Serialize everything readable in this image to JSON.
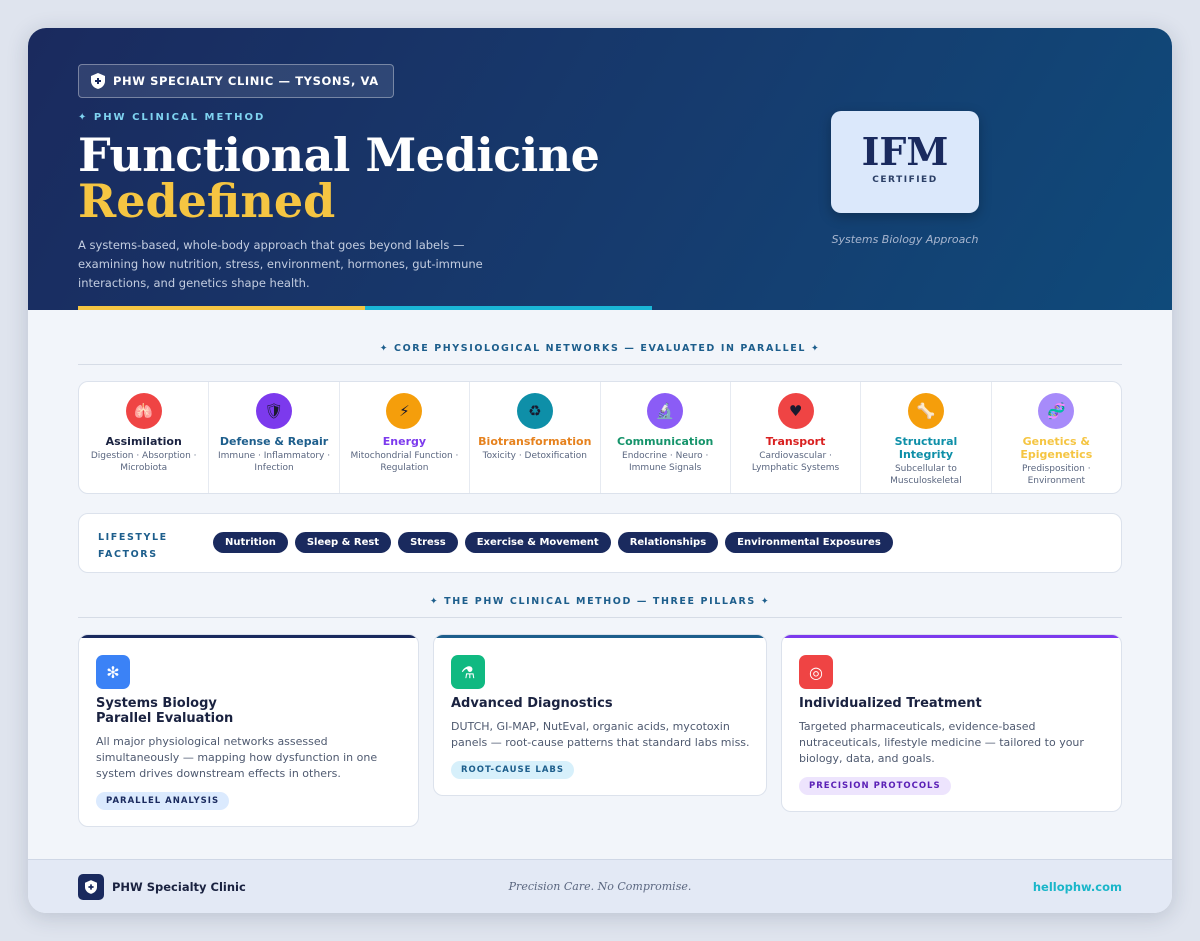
{
  "hero": {
    "badge": "PHW SPECIALTY CLINIC — TYSONS, VA",
    "eyebrow": "✦ PHW CLINICAL METHOD",
    "title_line1": "Functional Medicine",
    "title_line2": "Redefined",
    "description": "A systems-based, whole-body approach that goes beyond labels — examining how nutrition, stress, environment, hormones, gut-immune interactions, and genetics shape health.",
    "ifm_text": "IFM",
    "ifm_sub": "CERTIFIED",
    "ifm_caption": "Systems Biology Approach"
  },
  "networks_section": {
    "heading": "✦   CORE PHYSIOLOGICAL NETWORKS — EVALUATED IN PARALLEL   ✦",
    "items": [
      {
        "title": "Assimilation",
        "sub": "Digestion · Absorption · Microbiota",
        "icon": "lungs-icon",
        "glyph": "🫁",
        "icon_color": "#ef4444",
        "title_color": "#1a2240"
      },
      {
        "title": "Defense & Repair",
        "sub": "Immune · Inflammatory · Infection",
        "icon": "shield-icon",
        "glyph": "🛡",
        "icon_color": "#7c3aed",
        "title_color": "#1d5e8c"
      },
      {
        "title": "Energy",
        "sub": "Mitochondrial Function · Regulation",
        "icon": "lightning-icon",
        "glyph": "⚡",
        "icon_color": "#f59e0b",
        "title_color": "#7c3aed"
      },
      {
        "title": "Biotransformation",
        "sub": "Toxicity · Detoxification",
        "icon": "cycle-icon",
        "glyph": "♻",
        "icon_color": "#0e8fa8",
        "title_color": "#e6821e"
      },
      {
        "title": "Communication",
        "sub": "Endocrine · Neuro · Immune Signals",
        "icon": "microscope-icon",
        "glyph": "🔬",
        "icon_color": "#8b5cf6",
        "title_color": "#16946b"
      },
      {
        "title": "Transport",
        "sub": "Cardiovascular · Lymphatic Systems",
        "icon": "heart-icon",
        "glyph": "♥",
        "icon_color": "#ef4444",
        "title_color": "#d92020"
      },
      {
        "title": "Structural Integrity",
        "sub": "Subcellular to Musculoskeletal",
        "icon": "bone-icon",
        "glyph": "🦴",
        "icon_color": "#f59e0b",
        "title_color": "#0e8fa8"
      },
      {
        "title": "Genetics & Epigenetics",
        "sub": "Predisposition · Environment",
        "icon": "dna-icon",
        "glyph": "🧬",
        "icon_color": "#a78bfa",
        "title_color": "#f5c542"
      }
    ]
  },
  "lifestyle": {
    "label": "LIFESTYLE FACTORS",
    "pills": [
      "Nutrition",
      "Sleep & Rest",
      "Stress",
      "Exercise & Movement",
      "Relationships",
      "Environmental Exposures"
    ]
  },
  "pillars_section": {
    "heading": "✦   THE PHW CLINICAL METHOD — THREE PILLARS   ✦",
    "items": [
      {
        "title": "Systems Biology\nParallel Evaluation",
        "description": "All major physiological networks assessed simultaneously — mapping how dysfunction in one system drives downstream effects in others.",
        "tag": "PARALLEL ANALYSIS",
        "icon": "network-icon",
        "glyph": "✻",
        "icon_color": "#3b82f6",
        "accent": "#1a2a5e",
        "tag_bg": "#dbeafe",
        "tag_color": "#1a2a5e"
      },
      {
        "title": "Advanced Diagnostics",
        "description": "DUTCH, GI-MAP, NutEval, organic acids, mycotoxin panels — root-cause patterns that standard labs miss.",
        "tag": "ROOT-CAUSE LABS",
        "icon": "microscope-icon",
        "glyph": "⚗",
        "icon_color": "#10b981",
        "accent": "#1d5e8c",
        "tag_bg": "#d7f0fb",
        "tag_color": "#1d5e8c"
      },
      {
        "title": "Individualized Treatment",
        "description": "Targeted pharmaceuticals, evidence-based nutraceuticals, lifestyle medicine — tailored to your biology, data, and goals.",
        "tag": "PRECISION PROTOCOLS",
        "icon": "target-icon",
        "glyph": "◎",
        "icon_color": "#ef4444",
        "accent": "#7c3aed",
        "tag_bg": "#ede4fd",
        "tag_color": "#5b21b6"
      }
    ]
  },
  "footer": {
    "name": "PHW Specialty Clinic",
    "tagline": "Precision Care. No Compromise.",
    "url": "hellophw.com"
  }
}
